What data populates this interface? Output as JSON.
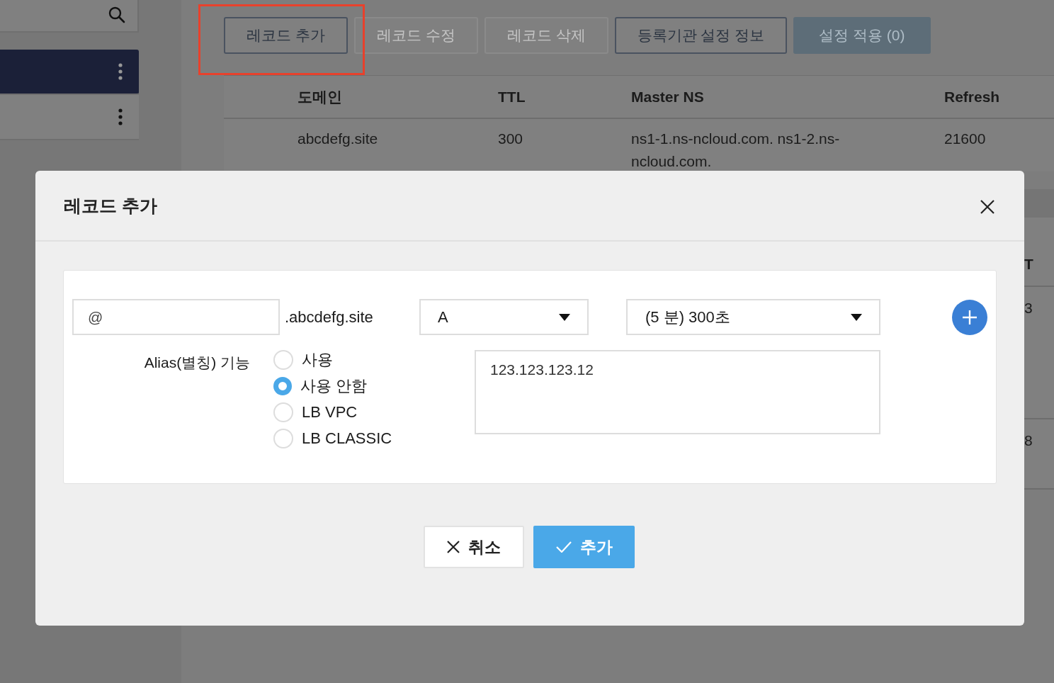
{
  "sidebar": {
    "items": [
      {
        "selected": true
      },
      {
        "selected": false
      }
    ]
  },
  "toolbar": {
    "buttons": [
      {
        "label": "레코드 추가",
        "disabled": false,
        "kind": "outline"
      },
      {
        "label": "레코드 수정",
        "disabled": true,
        "kind": "outline"
      },
      {
        "label": "레코드 삭제",
        "disabled": true,
        "kind": "outline"
      },
      {
        "label": "등록기관 설정 정보",
        "disabled": false,
        "kind": "outline"
      },
      {
        "label": "설정 적용 (0)",
        "disabled": true,
        "kind": "primary"
      }
    ]
  },
  "table": {
    "columns": [
      "도메인",
      "TTL",
      "Master NS",
      "Refresh"
    ],
    "rows": [
      [
        "abcdefg.site",
        "300",
        "ns1-1.ns-ncloud.com. ns1-2.ns-ncloud.com.",
        "21600"
      ]
    ]
  },
  "table_2": {
    "columns": [
      "T"
    ],
    "rows": [
      [
        "3"
      ],
      [
        "8"
      ]
    ]
  },
  "dialog": {
    "title": "레코드 추가",
    "name_field": {
      "value": "@"
    },
    "domain_suffix": ".abcdefg.site",
    "type_select": {
      "value": "A"
    },
    "ttl_select": {
      "value": "(5 분) 300초"
    },
    "alias": {
      "label": "Alias(별칭) 기능",
      "options": [
        {
          "label": "사용",
          "selected": false
        },
        {
          "label": "사용 안함",
          "selected": true
        },
        {
          "label": "LB VPC",
          "selected": false
        },
        {
          "label": "LB CLASSIC",
          "selected": false
        }
      ]
    },
    "value_field": {
      "value": "123.123.123.12"
    },
    "buttons": [
      {
        "label": "취소",
        "kind": "cancel"
      },
      {
        "label": "추가",
        "kind": "confirm"
      }
    ]
  }
}
